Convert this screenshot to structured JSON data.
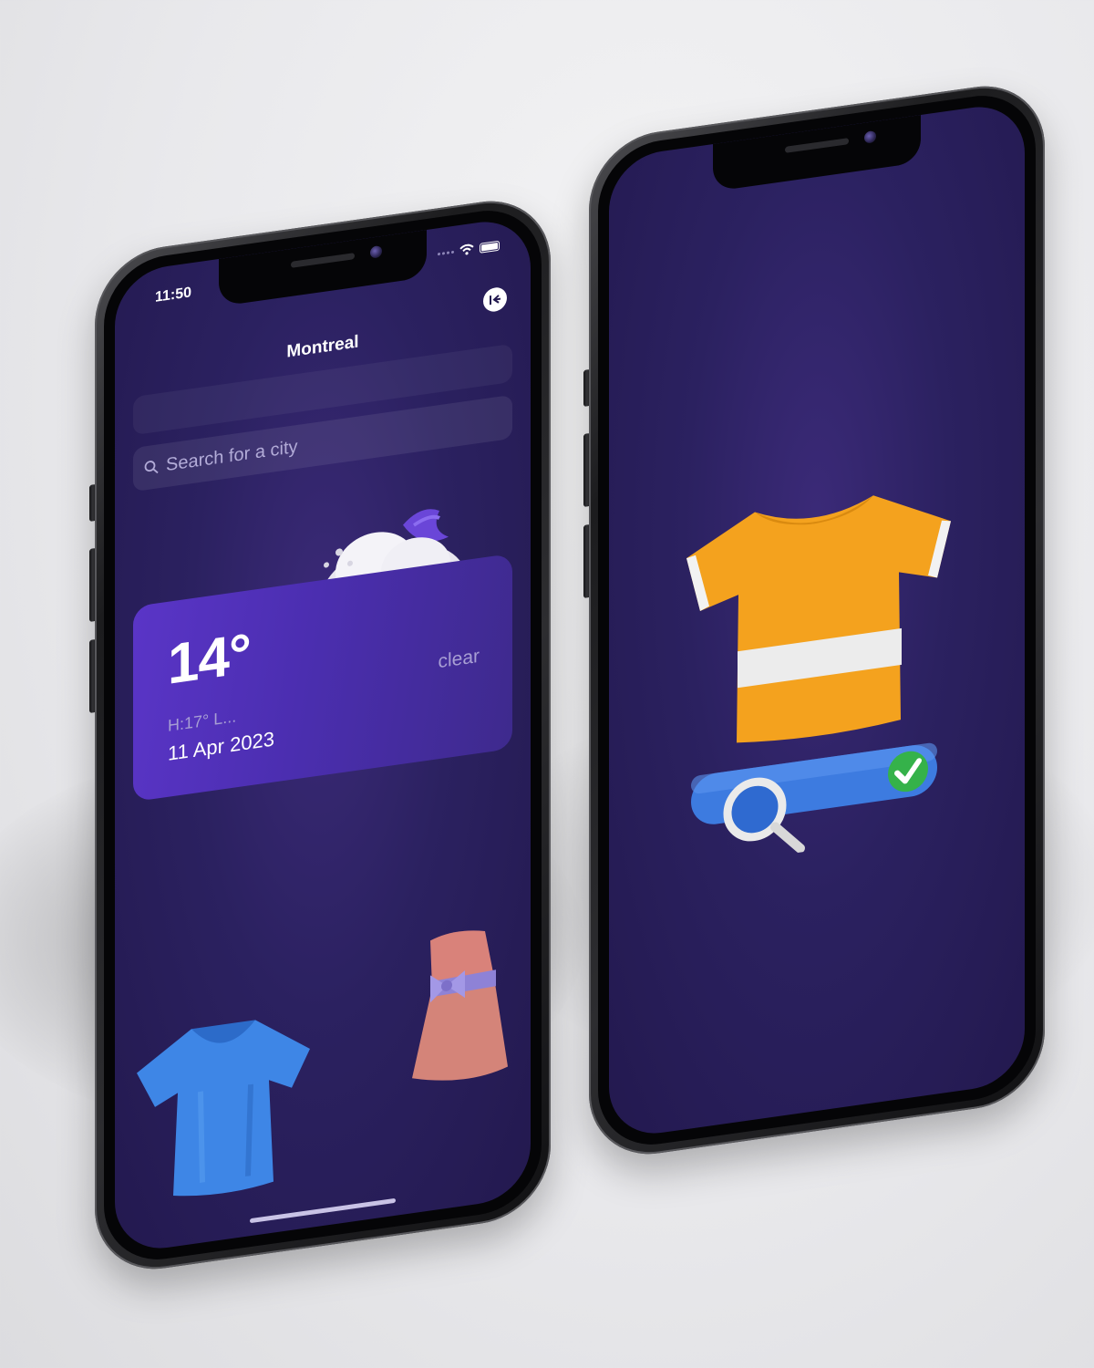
{
  "status_bar": {
    "time": "11:50"
  },
  "weather_screen": {
    "city": "Montreal",
    "search": {
      "placeholder": "Search for a city"
    },
    "current": {
      "temperature": "14°",
      "high_low": "H:17° L...",
      "date": "11 Apr 2023",
      "condition": "clear"
    }
  },
  "icons": {
    "back": "collapse-left-icon",
    "search": "search-icon",
    "weather": "cloudy-night-icon",
    "blue_shirt": "tshirt-icon",
    "dress": "dress-icon",
    "promo": "tshirt-search-icon"
  },
  "colors": {
    "screen_bg": "#2b2160",
    "card": "#5a35c7",
    "accent_orange": "#f4a21e",
    "accent_blue": "#3d7be0",
    "check_green": "#35b24a"
  }
}
